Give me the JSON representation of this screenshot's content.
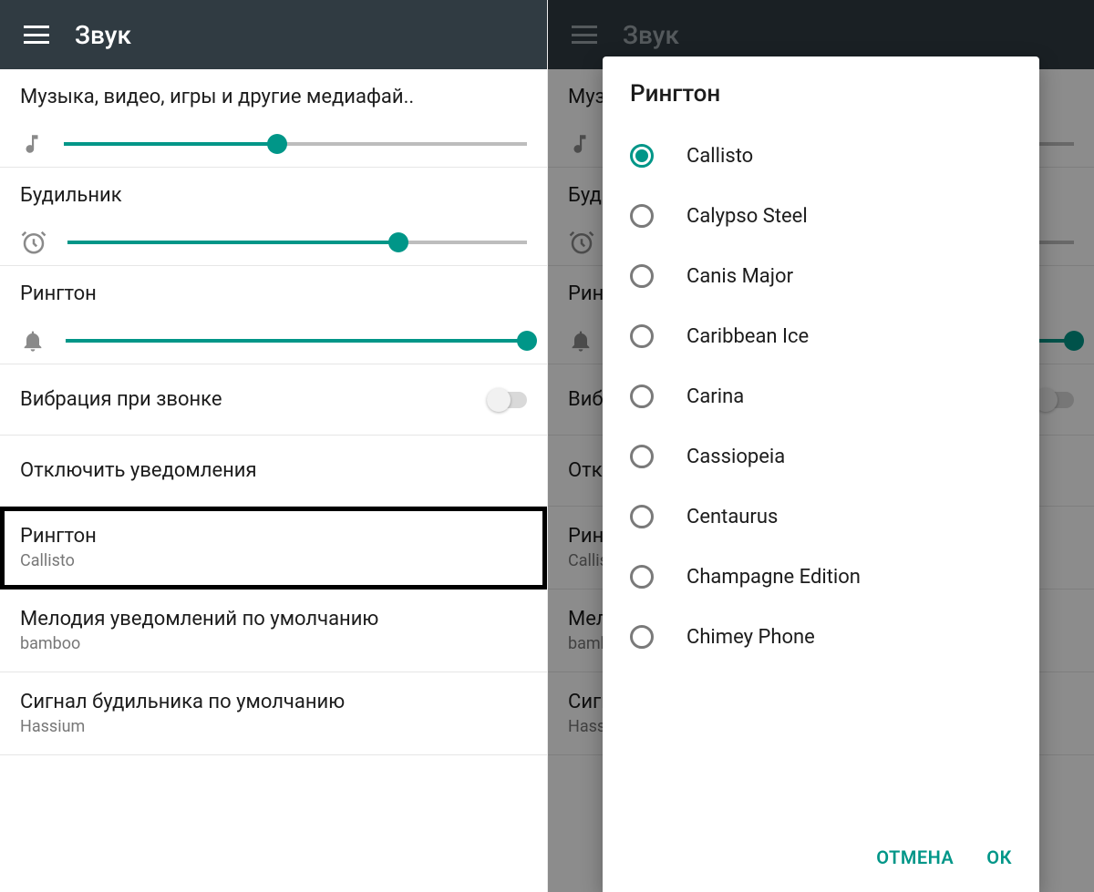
{
  "colors": {
    "accent": "#009688"
  },
  "left": {
    "header": {
      "title": "Звук"
    },
    "sliders": {
      "media": {
        "label": "Музыка, видео, игры и другие медиафай..",
        "percent": 46
      },
      "alarm": {
        "label": "Будильник",
        "percent": 72
      },
      "ring": {
        "label": "Рингтон",
        "percent": 100
      }
    },
    "vibrate": {
      "label": "Вибрация при звонке",
      "on": false
    },
    "dnd": {
      "label": "Отключить уведомления"
    },
    "ringtone": {
      "title": "Рингтон",
      "value": "Callisto"
    },
    "notification": {
      "title": "Мелодия уведомлений по умолчанию",
      "value": "bamboo"
    },
    "alarm_tone": {
      "title": "Сигнал будильника по умолчанию",
      "value": "Hassium"
    }
  },
  "right": {
    "header": {
      "title": "Звук"
    },
    "dialog": {
      "title": "Рингтон",
      "selected": 0,
      "options": [
        "Callisto",
        "Calypso Steel",
        "Canis Major",
        "Caribbean Ice",
        "Carina",
        "Cassiopeia",
        "Centaurus",
        "Champagne Edition",
        "Chimey Phone"
      ],
      "cancel": "ОТМЕНА",
      "ok": "ОК"
    }
  }
}
